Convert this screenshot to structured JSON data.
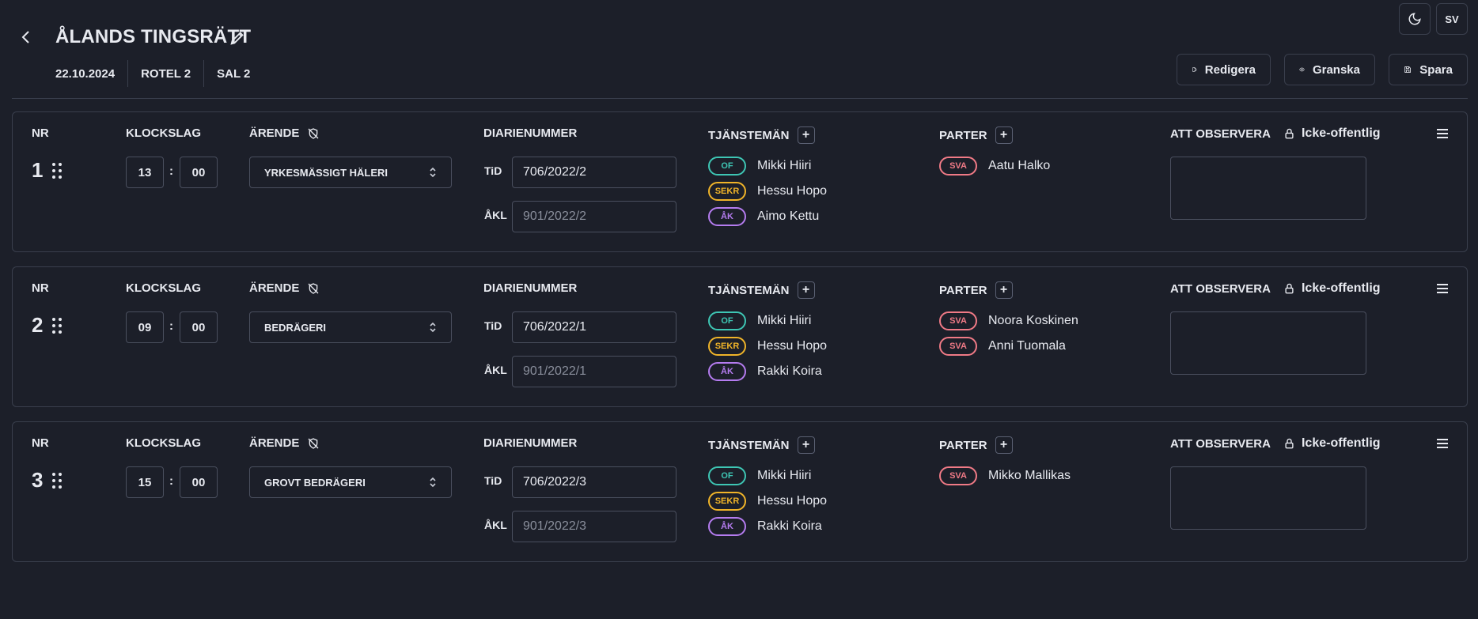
{
  "header": {
    "title": "ÅLANDS TINGSRÄTT",
    "meta": [
      "22.10.2024",
      "ROTEL 2",
      "SAL 2"
    ],
    "lang_label": "SV",
    "actions": {
      "edit": "Redigera",
      "review": "Granska",
      "save": "Spara"
    }
  },
  "labels": {
    "nr": "NR",
    "time": "KLOCKSLAG",
    "case": "ÄRENDE",
    "diary": "DIARIENUMMER",
    "officials": "TJÄNSTEMÄN",
    "parties": "PARTER",
    "notes": "ATT OBSERVERA",
    "private": "Icke-offentlig",
    "tid": "TiD",
    "akl": "ÅKL"
  },
  "cases": [
    {
      "nr": "1",
      "hour": "13",
      "minute": "00",
      "case": "YRKESMÄSSIGT HÄLERI",
      "tid": "706/2022/2",
      "akl": "901/2022/2",
      "officials": [
        {
          "role": "OF",
          "name": "Mikki Hiiri"
        },
        {
          "role": "SEKR",
          "name": "Hessu Hopo"
        },
        {
          "role": "ÅK",
          "name": "Aimo Kettu"
        }
      ],
      "parties": [
        {
          "role": "SVA",
          "name": "Aatu Halko"
        }
      ]
    },
    {
      "nr": "2",
      "hour": "09",
      "minute": "00",
      "case": "BEDRÄGERI",
      "tid": "706/2022/1",
      "akl": "901/2022/1",
      "officials": [
        {
          "role": "OF",
          "name": "Mikki Hiiri"
        },
        {
          "role": "SEKR",
          "name": "Hessu Hopo"
        },
        {
          "role": "ÅK",
          "name": "Rakki Koira"
        }
      ],
      "parties": [
        {
          "role": "SVA",
          "name": "Noora Koskinen"
        },
        {
          "role": "SVA",
          "name": "Anni Tuomala"
        }
      ]
    },
    {
      "nr": "3",
      "hour": "15",
      "minute": "00",
      "case": "GROVT BEDRÄGERI",
      "tid": "706/2022/3",
      "akl": "901/2022/3",
      "officials": [
        {
          "role": "OF",
          "name": "Mikki Hiiri"
        },
        {
          "role": "SEKR",
          "name": "Hessu Hopo"
        },
        {
          "role": "ÅK",
          "name": "Rakki Koira"
        }
      ],
      "parties": [
        {
          "role": "SVA",
          "name": "Mikko Mallikas"
        }
      ]
    }
  ],
  "colors": {
    "background": "#1c1f29",
    "border": "#3a3f4d",
    "of": "#3ec6b4",
    "sekr": "#f0b429",
    "ak": "#b57cf0",
    "sva": "#f07a86"
  }
}
